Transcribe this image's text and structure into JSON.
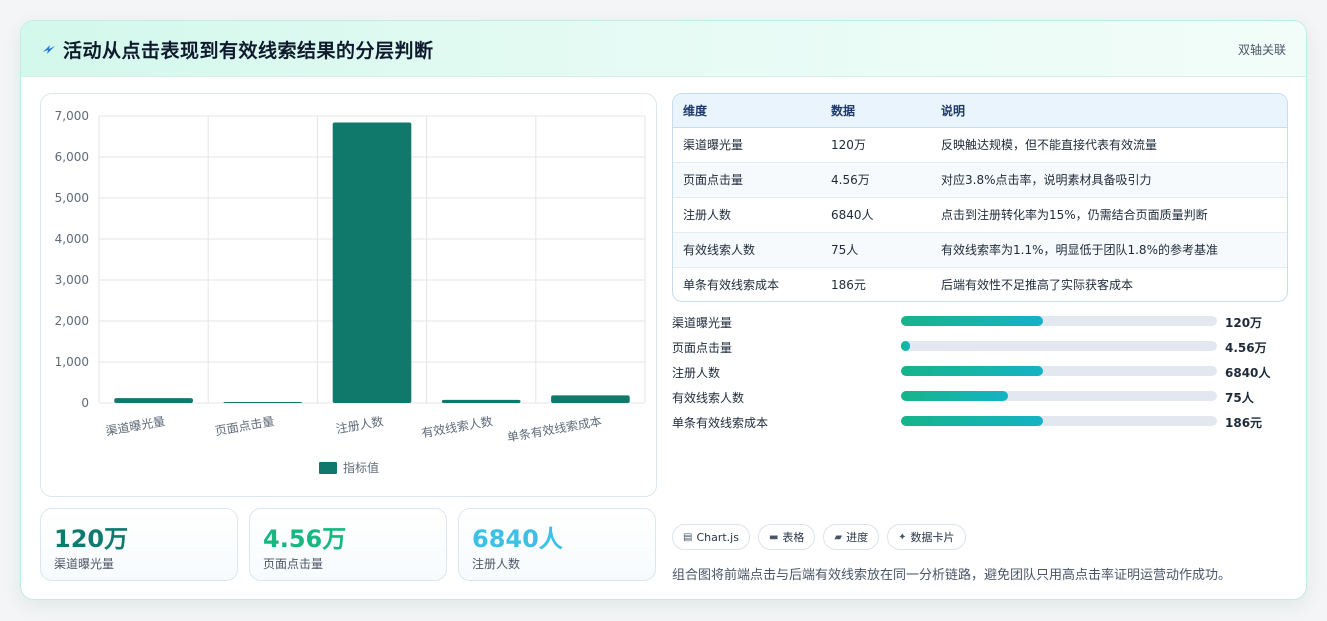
{
  "header": {
    "title": "活动从点击表现到有效线索结果的分层判断",
    "tag": "双轴关联",
    "icon": "lightning-icon"
  },
  "chart_data": {
    "type": "bar",
    "categories": [
      "渠道曝光量",
      "页面点击量",
      "注册人数",
      "有效线索人数",
      "单条有效线索成本"
    ],
    "series": [
      {
        "name": "指标值",
        "values": [
          120,
          4.56,
          6840,
          75,
          186
        ]
      }
    ],
    "yticks": [
      "0",
      "1,000",
      "2,000",
      "3,000",
      "4,000",
      "5,000",
      "6,000",
      "7,000"
    ],
    "ylim": [
      0,
      7000
    ],
    "grid": true,
    "legend": "bottom",
    "color": "#11786c"
  },
  "stats": [
    {
      "value": "120万",
      "label": "渠道曝光量",
      "color": "#0f7a6e"
    },
    {
      "value": "4.56万",
      "label": "页面点击量",
      "color": "#16b87f"
    },
    {
      "value": "6840人",
      "label": "注册人数",
      "color": "#3cc0e6"
    }
  ],
  "table": {
    "headers": [
      "维度",
      "数据",
      "说明"
    ],
    "rows": [
      [
        "渠道曝光量",
        "120万",
        "反映触达规模，但不能直接代表有效流量"
      ],
      [
        "页面点击量",
        "4.56万",
        "对应3.8%点击率，说明素材具备吸引力"
      ],
      [
        "注册人数",
        "6840人",
        "点击到注册转化率为15%，仍需结合页面质量判断"
      ],
      [
        "有效线索人数",
        "75人",
        "有效线索率为1.1%，明显低于团队1.8%的参考基准"
      ],
      [
        "单条有效线索成本",
        "186元",
        "后端有效性不足推高了实际获客成本"
      ]
    ]
  },
  "progress": [
    {
      "label": "渠道曝光量",
      "value": "120万",
      "fraction": 0.45
    },
    {
      "label": "页面点击量",
      "value": "4.56万",
      "fraction": 0.03
    },
    {
      "label": "注册人数",
      "value": "6840人",
      "fraction": 0.45
    },
    {
      "label": "有效线索人数",
      "value": "75人",
      "fraction": 0.34
    },
    {
      "label": "单条有效线索成本",
      "value": "186元",
      "fraction": 0.45
    }
  ],
  "chips": [
    {
      "icon": "▤",
      "icon_name": "chart-icon",
      "label": "Chart.js"
    },
    {
      "icon": "▬",
      "icon_name": "table-icon",
      "label": "表格"
    },
    {
      "icon": "▰",
      "icon_name": "progress-icon",
      "label": "进度"
    },
    {
      "icon": "✦",
      "icon_name": "sparkle-icon",
      "label": "数据卡片"
    }
  ],
  "note": "组合图将前端点击与后端有效线索放在同一分析链路，避免团队只用高点击率证明运营动作成功。"
}
